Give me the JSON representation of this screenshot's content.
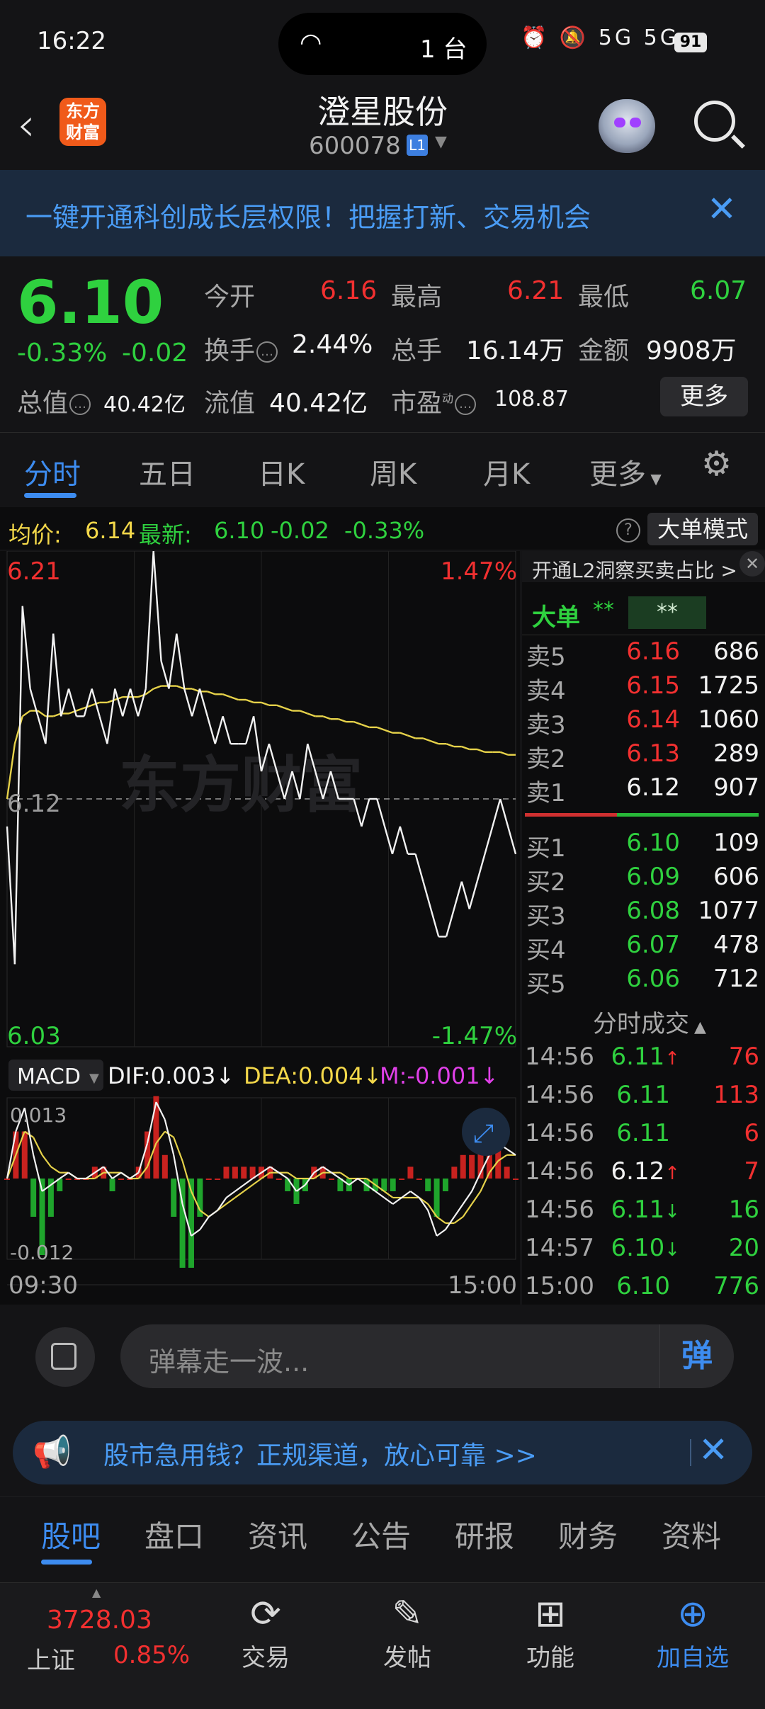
{
  "status_bar": {
    "time": "16:22",
    "island_count": "1 台",
    "signal": "5G 5G",
    "battery": "91"
  },
  "header": {
    "back_icon": "back-arrow-icon",
    "logo_text": "东方\n财富",
    "stock_name": "澄星股份",
    "stock_code": "600078",
    "level_badge": "L1"
  },
  "banner": {
    "text": "一键开通科创成长层权限！把握打新、交易机会"
  },
  "quote": {
    "price": "6.10",
    "change_pct": "-0.33%",
    "change": "-0.02",
    "open_label": "今开",
    "open": "6.16",
    "high_label": "最高",
    "high": "6.21",
    "low_label": "最低",
    "low": "6.07",
    "turnover_label": "换手",
    "turnover": "2.44%",
    "volume_label": "总手",
    "volume": "16.14万",
    "amount_label": "金额",
    "amount": "9908万",
    "total_cap_label": "总值",
    "total_cap": "40.42亿",
    "float_cap_label": "流值",
    "float_cap": "40.42亿",
    "pe_label": "市盈",
    "pe_sup": "动",
    "pe": "108.87",
    "more_label": "更多"
  },
  "chart_tabs": {
    "items": [
      "分时",
      "五日",
      "日K",
      "周K",
      "月K",
      "更多"
    ],
    "active": 0
  },
  "avg_row": {
    "avg_label": "均价:",
    "avg": "6.14",
    "latest_label": "最新:",
    "latest": "6.10",
    "change": "-0.02",
    "change_pct": "-0.33%",
    "mode_label": "大单模式"
  },
  "chart_data": {
    "type": "line",
    "price_axis": {
      "top": "6.21",
      "mid": "6.12",
      "bottom": "6.03",
      "top_pct": "1.47%",
      "bottom_pct": "-1.47%"
    },
    "x_labels": [
      "09:30",
      "15:00"
    ],
    "watermark": "东方财富",
    "price_series": [
      6.11,
      6.06,
      6.19,
      6.16,
      6.15,
      6.14,
      6.18,
      6.15,
      6.16,
      6.15,
      6.15,
      6.16,
      6.15,
      6.14,
      6.16,
      6.15,
      6.16,
      6.15,
      6.16,
      6.21,
      6.17,
      6.16,
      6.18,
      6.16,
      6.15,
      6.16,
      6.15,
      6.14,
      6.15,
      6.14,
      6.14,
      6.14,
      6.15,
      6.13,
      6.14,
      6.13,
      6.12,
      6.13,
      6.12,
      6.14,
      6.13,
      6.12,
      6.13,
      6.12,
      6.12,
      6.12,
      6.11,
      6.12,
      6.12,
      6.11,
      6.1,
      6.11,
      6.1,
      6.1,
      6.09,
      6.08,
      6.07,
      6.07,
      6.08,
      6.09,
      6.08,
      6.09,
      6.1,
      6.11,
      6.12,
      6.11,
      6.1
    ],
    "avg_series": [
      6.12,
      6.14,
      6.15,
      6.152,
      6.152,
      6.15,
      6.15,
      6.151,
      6.151,
      6.152,
      6.153,
      6.154,
      6.155,
      6.155,
      6.156,
      6.157,
      6.157,
      6.157,
      6.158,
      6.16,
      6.161,
      6.161,
      6.161,
      6.16,
      6.16,
      6.159,
      6.159,
      6.158,
      6.158,
      6.157,
      6.156,
      6.156,
      6.155,
      6.155,
      6.154,
      6.154,
      6.153,
      6.152,
      6.152,
      6.151,
      6.15,
      6.15,
      6.149,
      6.149,
      6.148,
      6.148,
      6.147,
      6.146,
      6.146,
      6.145,
      6.144,
      6.144,
      6.143,
      6.142,
      6.142,
      6.141,
      6.14,
      6.14,
      6.139,
      6.139,
      6.138,
      6.138,
      6.137,
      6.137,
      6.137,
      6.136,
      6.136
    ],
    "macd": {
      "dif": "DIF:0.003↓",
      "dea": "DEA:0.004↓",
      "m": "M:-0.001↓",
      "selector": "MACD",
      "top": "0.013",
      "bottom": "-0.012",
      "dif_series": [
        0.0,
        0.008,
        0.012,
        0.004,
        -0.002,
        -0.001,
        0.0,
        0.001,
        0.0,
        0.0,
        0.001,
        0.002,
        0.0,
        0.001,
        0.0,
        0.001,
        0.006,
        0.013,
        0.01,
        0.004,
        -0.004,
        -0.009,
        -0.008,
        -0.006,
        -0.005,
        -0.003,
        -0.002,
        -0.001,
        0.0,
        0.001,
        0.002,
        0.001,
        0.0,
        -0.002,
        -0.001,
        0.001,
        0.002,
        0.001,
        0.0,
        -0.001,
        0.0,
        -0.001,
        -0.002,
        -0.003,
        -0.004,
        -0.003,
        -0.002,
        -0.003,
        -0.005,
        -0.009,
        -0.008,
        -0.006,
        -0.004,
        -0.002,
        0.001,
        0.004,
        0.006,
        0.005,
        0.004
      ],
      "dea_series": [
        0.0,
        0.004,
        0.008,
        0.007,
        0.004,
        0.002,
        0.001,
        0.001,
        0.0,
        0.0,
        0.0,
        0.001,
        0.001,
        0.001,
        0.0,
        0.0,
        0.002,
        0.006,
        0.008,
        0.007,
        0.003,
        -0.002,
        -0.005,
        -0.006,
        -0.005,
        -0.004,
        -0.003,
        -0.002,
        -0.001,
        0.0,
        0.001,
        0.001,
        0.001,
        0.0,
        0.0,
        0.0,
        0.001,
        0.001,
        0.001,
        0.0,
        0.0,
        0.0,
        -0.001,
        -0.002,
        -0.003,
        -0.003,
        -0.003,
        -0.003,
        -0.004,
        -0.006,
        -0.007,
        -0.007,
        -0.006,
        -0.004,
        -0.002,
        0.001,
        0.003,
        0.004,
        0.004
      ]
    }
  },
  "order_book": {
    "l2_link": "开通L2洞察买卖占比 >",
    "big_order_label": "大单",
    "big_order_val1": "**",
    "big_order_val2": "**",
    "asks": [
      {
        "label": "卖5",
        "price": "6.16",
        "vol": "686"
      },
      {
        "label": "卖4",
        "price": "6.15",
        "vol": "1725"
      },
      {
        "label": "卖3",
        "price": "6.14",
        "vol": "1060"
      },
      {
        "label": "卖2",
        "price": "6.13",
        "vol": "289"
      },
      {
        "label": "卖1",
        "price": "6.12",
        "vol": "907"
      }
    ],
    "bids": [
      {
        "label": "买1",
        "price": "6.10",
        "vol": "109"
      },
      {
        "label": "买2",
        "price": "6.09",
        "vol": "606"
      },
      {
        "label": "买3",
        "price": "6.08",
        "vol": "1077"
      },
      {
        "label": "买4",
        "price": "6.07",
        "vol": "478"
      },
      {
        "label": "买5",
        "price": "6.06",
        "vol": "712"
      }
    ],
    "ticks_title": "分时成交",
    "ticks": [
      {
        "time": "14:56",
        "price": "6.11",
        "arrow": "↑",
        "vol": "76"
      },
      {
        "time": "14:56",
        "price": "6.11",
        "arrow": "",
        "vol": "113"
      },
      {
        "time": "14:56",
        "price": "6.11",
        "arrow": "",
        "vol": "6"
      },
      {
        "time": "14:56",
        "price": "6.12",
        "arrow": "↑",
        "vol": "7"
      },
      {
        "time": "14:56",
        "price": "6.11",
        "arrow": "↓",
        "vol": "16"
      },
      {
        "time": "14:57",
        "price": "6.10",
        "arrow": "↓",
        "vol": "20"
      },
      {
        "time": "15:00",
        "price": "6.10",
        "arrow": "",
        "vol": "776"
      }
    ]
  },
  "comment_bar": {
    "placeholder": "弹幕走一波...",
    "danmu_label": "弹"
  },
  "ad": {
    "text": "股市急用钱？正规渠道，放心可靠 >>"
  },
  "bottom_tabs": {
    "items": [
      "股吧",
      "盘口",
      "资讯",
      "公告",
      "研报",
      "财务",
      "资料"
    ],
    "active": 0
  },
  "footer": {
    "index_value": "3728.03",
    "index_name": "上证",
    "index_pct": "0.85%",
    "items": [
      {
        "label": "交易",
        "icon": "trade-icon"
      },
      {
        "label": "发帖",
        "icon": "compose-icon"
      },
      {
        "label": "功能",
        "icon": "grid-icon"
      },
      {
        "label": "加自选",
        "icon": "add-watchlist-icon"
      }
    ]
  }
}
